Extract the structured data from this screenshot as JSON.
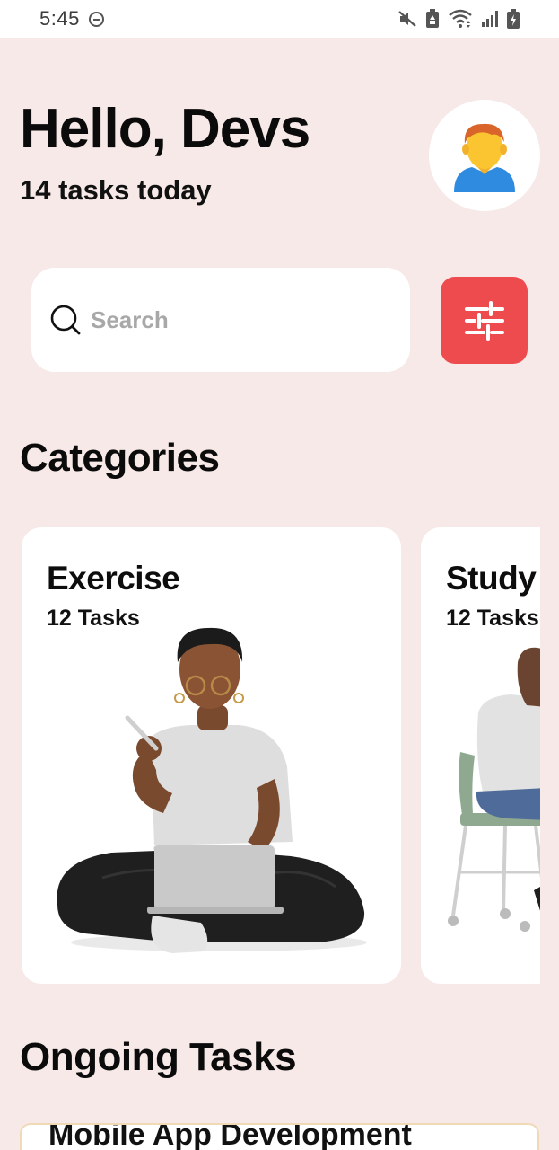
{
  "status_bar": {
    "time": "5:45",
    "icons": [
      "do-not-disturb-icon",
      "mute-icon",
      "battery-saver-icon",
      "wifi-icon",
      "signal-icon",
      "battery-charging-icon"
    ]
  },
  "header": {
    "greeting": "Hello, Devs",
    "subtitle": "14 tasks today",
    "avatar_icon": "user-avatar-icon"
  },
  "search": {
    "placeholder": "Search",
    "value": "",
    "search_icon": "search-icon",
    "filter_icon": "sliders-icon"
  },
  "categories": {
    "title": "Categories",
    "items": [
      {
        "title": "Exercise",
        "count": "12 Tasks",
        "illustration": "person-with-laptop-illustration"
      },
      {
        "title": "Study",
        "count": "12 Tasks",
        "illustration": "person-on-chair-illustration"
      }
    ]
  },
  "ongoing": {
    "title": "Ongoing Tasks",
    "tasks": [
      {
        "title": "Mobile App Development"
      }
    ]
  },
  "colors": {
    "background": "#f6e9e7",
    "accent": "#ee4b4f",
    "card": "#ffffff",
    "ongoing_border": "#efd9b7"
  }
}
